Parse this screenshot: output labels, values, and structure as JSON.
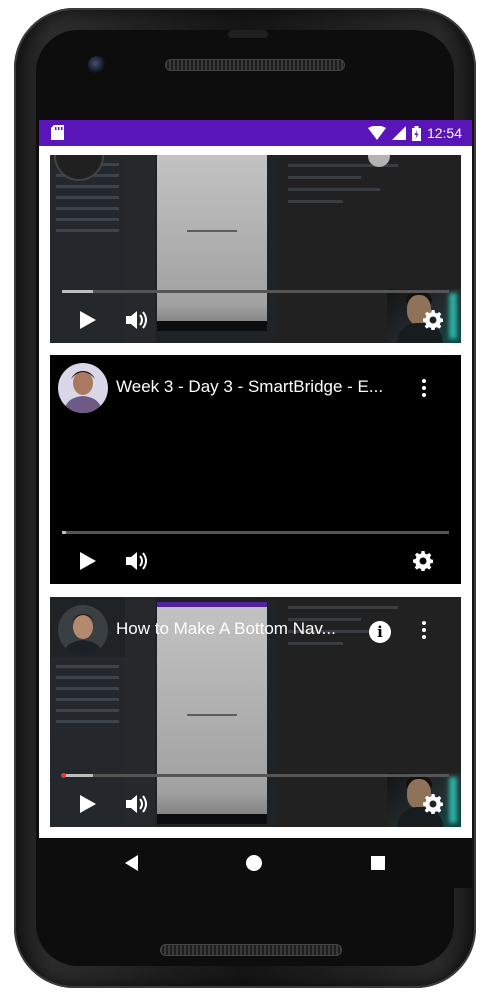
{
  "status_bar": {
    "time": "12:54",
    "icons": [
      "sd-card-icon",
      "wifi-icon",
      "signal-icon",
      "battery-icon"
    ],
    "background": "#5a15b8"
  },
  "videos": [
    {
      "title": "",
      "progress_fraction": 0.08,
      "controls": [
        "play-icon",
        "volume-icon",
        "gear-icon"
      ]
    },
    {
      "title": "Week 3 - Day 3 - SmartBridge - E...",
      "progress_fraction": 0.01,
      "controls": [
        "play-icon",
        "volume-icon",
        "gear-icon"
      ]
    },
    {
      "title": "How to Make A Bottom Nav...",
      "progress_fraction": 0.08,
      "controls": [
        "play-icon",
        "volume-icon",
        "gear-icon"
      ]
    }
  ],
  "nav_bar": {
    "buttons": [
      "back-icon",
      "home-icon",
      "recents-icon"
    ]
  }
}
